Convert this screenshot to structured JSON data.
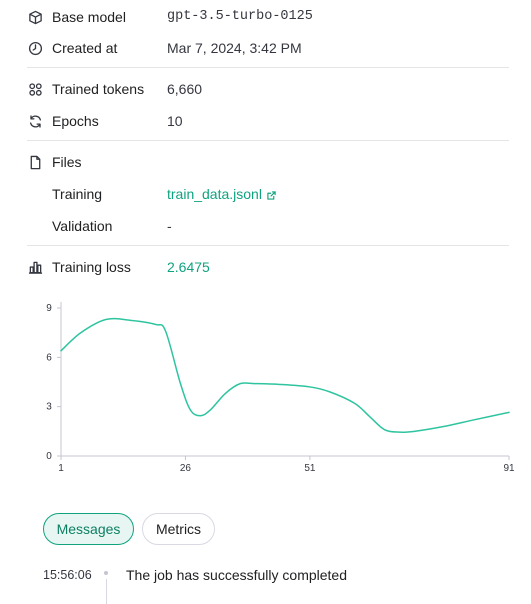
{
  "details": {
    "base_model": {
      "label": "Base model",
      "value": "gpt-3.5-turbo-0125",
      "icon": "cube-icon"
    },
    "created_at": {
      "label": "Created at",
      "value": "Mar 7, 2024, 3:42 PM",
      "icon": "clock-icon"
    },
    "trained_tokens": {
      "label": "Trained tokens",
      "value": "6,660",
      "icon": "grid-dots-icon"
    },
    "epochs": {
      "label": "Epochs",
      "value": "10",
      "icon": "refresh-icon"
    },
    "files": {
      "label": "Files",
      "icon": "file-icon"
    },
    "training": {
      "label": "Training",
      "value": "train_data.jsonl",
      "icon": "external-link-icon"
    },
    "validation": {
      "label": "Validation",
      "value": "-"
    },
    "training_loss": {
      "label": "Training loss",
      "value": "2.6475",
      "icon": "bar-chart-icon"
    }
  },
  "colors": {
    "accent": "#10a37f",
    "line": "#2ec4a0",
    "axis": "#c5c5d2",
    "tick_text": "#353740"
  },
  "chart_data": {
    "type": "line",
    "title": "",
    "xlabel": "",
    "ylabel": "",
    "xlim": [
      1,
      91
    ],
    "ylim": [
      0,
      9
    ],
    "x_ticks": [
      "1",
      "26",
      "51",
      "91"
    ],
    "y_ticks": [
      "9",
      "6",
      "3",
      "0"
    ],
    "series": [
      {
        "x": [
          1,
          5,
          10,
          15,
          20,
          22,
          25,
          27,
          29,
          31,
          34,
          37,
          40,
          45,
          51,
          55,
          60,
          63,
          66,
          69,
          72,
          78,
          84,
          91
        ],
        "y": [
          6.4,
          7.5,
          8.3,
          8.25,
          8.0,
          7.6,
          4.4,
          2.8,
          2.45,
          2.8,
          3.8,
          4.4,
          4.4,
          4.35,
          4.2,
          3.9,
          3.2,
          2.4,
          1.6,
          1.45,
          1.5,
          1.8,
          2.2,
          2.65
        ]
      }
    ],
    "grid": false
  },
  "tabs": {
    "messages": "Messages",
    "metrics": "Metrics"
  },
  "events": [
    {
      "time": "15:56:06",
      "text": "The job has successfully completed"
    }
  ]
}
